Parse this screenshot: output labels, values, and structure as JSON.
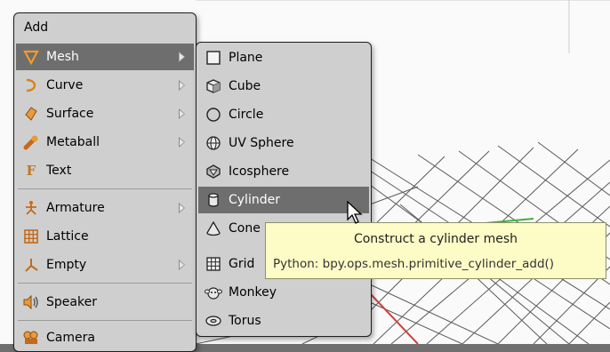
{
  "add_menu": {
    "title": "Add",
    "items": [
      {
        "label": "Mesh",
        "icon": "mesh-icon",
        "submenu": true,
        "highlighted": true
      },
      {
        "label": "Curve",
        "icon": "curve-icon",
        "submenu": true
      },
      {
        "label": "Surface",
        "icon": "surface-icon",
        "submenu": true
      },
      {
        "label": "Metaball",
        "icon": "metaball-icon",
        "submenu": true
      },
      {
        "label": "Text",
        "icon": "text-icon",
        "submenu": false
      },
      {
        "label": "Armature",
        "icon": "armature-icon",
        "submenu": true
      },
      {
        "label": "Lattice",
        "icon": "lattice-icon",
        "submenu": false
      },
      {
        "label": "Empty",
        "icon": "empty-icon",
        "submenu": true
      },
      {
        "label": "Speaker",
        "icon": "speaker-icon",
        "submenu": false
      },
      {
        "label": "Camera",
        "icon": "camera-icon",
        "submenu": false
      }
    ]
  },
  "mesh_menu": {
    "items": [
      {
        "label": "Plane",
        "icon": "plane-icon"
      },
      {
        "label": "Cube",
        "icon": "cube-icon"
      },
      {
        "label": "Circle",
        "icon": "circle-icon"
      },
      {
        "label": "UV Sphere",
        "icon": "uv-sphere-icon"
      },
      {
        "label": "Icosphere",
        "icon": "icosphere-icon"
      },
      {
        "label": "Cylinder",
        "icon": "cylinder-icon",
        "highlighted": true
      },
      {
        "label": "Cone",
        "icon": "cone-icon"
      },
      {
        "label": "Grid",
        "icon": "grid-icon"
      },
      {
        "label": "Monkey",
        "icon": "monkey-icon"
      },
      {
        "label": "Torus",
        "icon": "torus-icon"
      }
    ]
  },
  "tooltip": {
    "description": "Construct a cylinder mesh",
    "python": "Python: bpy.ops.mesh.primitive_cylinder_add()"
  },
  "colors": {
    "menu_bg": "#cfcfcf",
    "highlight": "#6e6e6e",
    "tooltip_bg": "#fdfbc6",
    "viewport_bg": "#fafafa",
    "axis_red": "#d04040",
    "axis_green": "#40b040"
  }
}
